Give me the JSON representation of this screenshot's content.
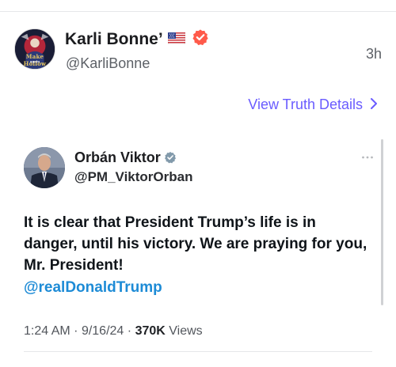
{
  "post": {
    "author_name": "Karli Bonne’",
    "author_handle": "@KarliBonne",
    "time_ago": "3h",
    "avatar_text_line1": "Make Hollow",
    "avatar_text_line2": "again",
    "flag_icon": "us-flag-icon",
    "verified_icon": "verified-badge-icon",
    "verified_color": "#ff5a4a"
  },
  "view_details": {
    "label": "View Truth Details",
    "color": "#6a5cff"
  },
  "embed": {
    "author_name": "Orbán Viktor",
    "author_handle": "@PM_ViktorOrban",
    "body": "It is clear that President Trump’s life is in danger, until his victory. We are praying for you, Mr. President!",
    "mention": "@realDonaldTrump",
    "mention_color": "#1d8bd6",
    "time": "1:24 AM",
    "date": "9/16/24",
    "views_count": "370K",
    "views_label": "Views",
    "separator": "·"
  }
}
